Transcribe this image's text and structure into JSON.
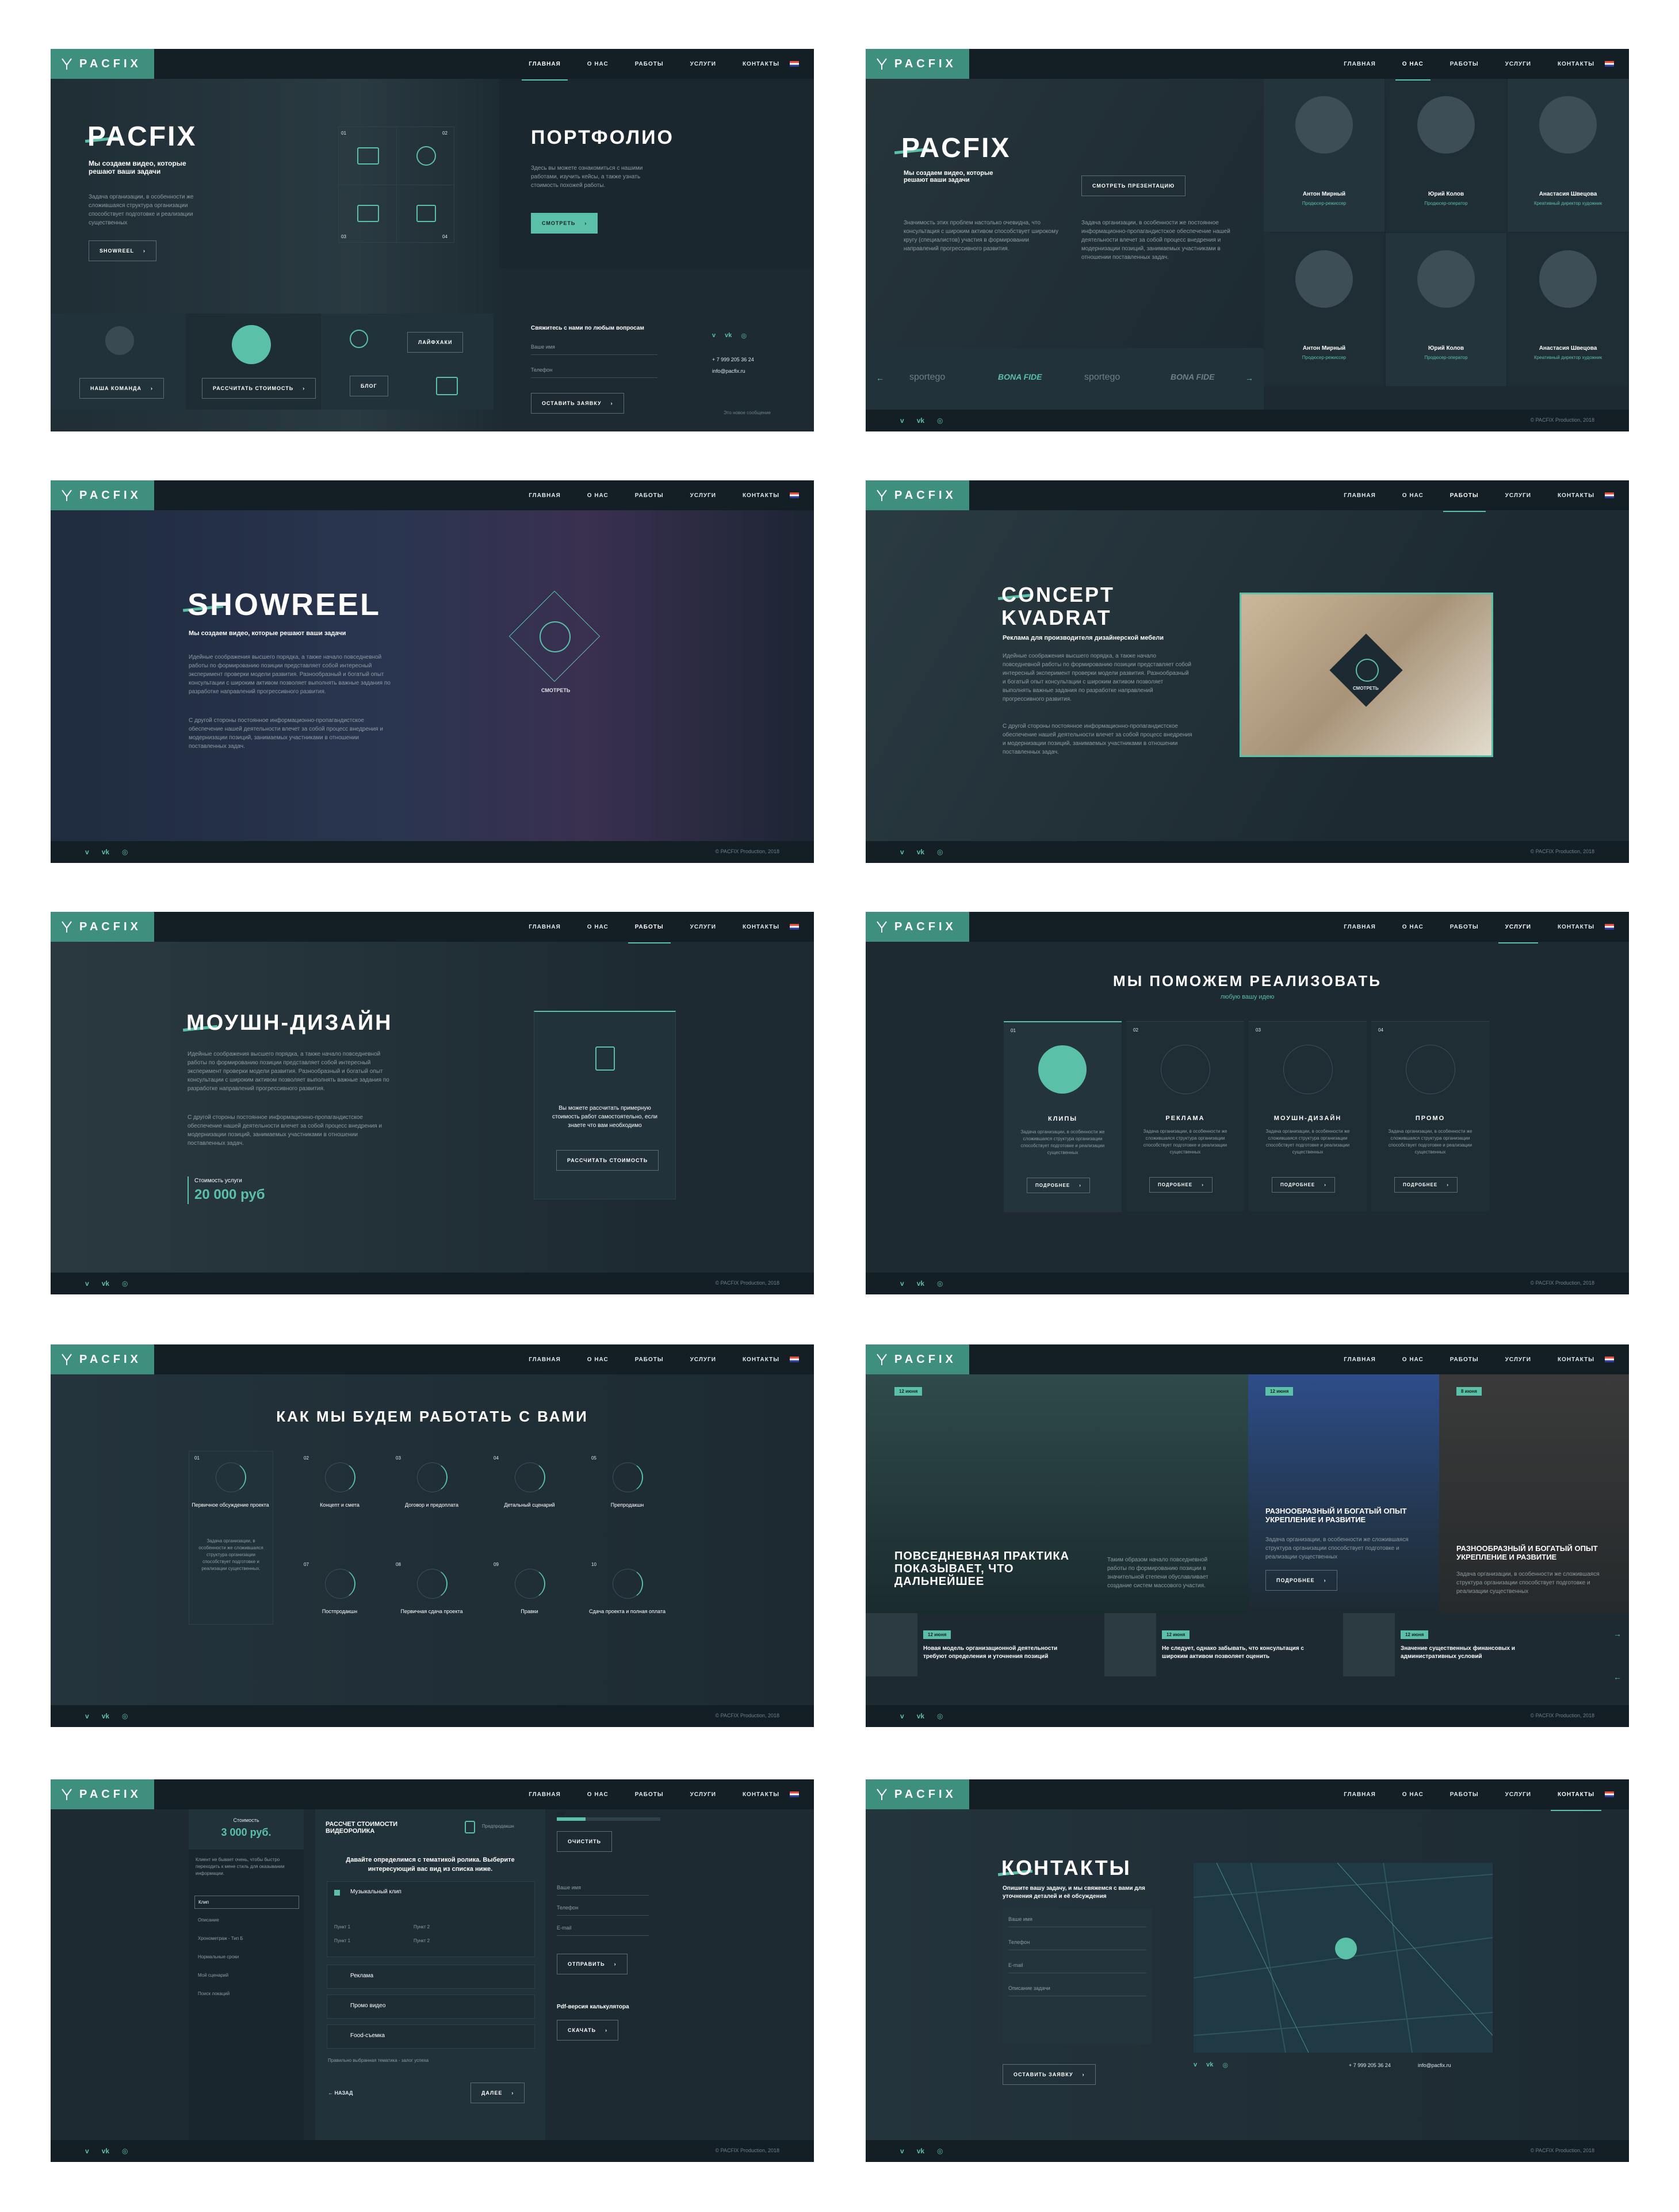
{
  "brand": {
    "name": "PACFIX",
    "accent": "#5bc0a8",
    "logo_bg": "#3f8f7e",
    "dark": "#1d2a32"
  },
  "nav": {
    "main": "ГЛАВНАЯ",
    "about": "О НАС",
    "works": "РАБОТЫ",
    "services": "УСЛУГИ",
    "contacts": "КОНТАКТЫ"
  },
  "footer": {
    "vimeo": "v",
    "vk": "vk",
    "instagram": "◎",
    "copyright": "© PACFIX Production, 2018"
  },
  "s1": {
    "title": "PACFIX",
    "tagline": "Мы создаем видео, которые решают ваши задачи",
    "text": "Задача организации, в особенности же сложившаяся структура организации способствует подготовке и реализации существенных",
    "showreel": "SHOWREEL",
    "n1": "01",
    "n2": "02",
    "n3": "03",
    "n4": "04",
    "portfolio": "ПОРТФОЛИО",
    "portfolio_text": "Здесь вы можете ознакомиться с нашими работами, изучить кейсы, а также узнать стоимость похожей работы.",
    "watch": "СМОТРЕТЬ",
    "team": "НАША КОМАНДА",
    "calc": "РАССЧИТАТЬ СТОИМОСТЬ",
    "lifehack": "ЛАЙФХАКИ",
    "blog": "БЛОГ",
    "contact_head": "Свяжитесь с нами по любым вопросам",
    "name_ph": "Ваше имя",
    "phone_ph": "Телефон",
    "send": "ОСТАВИТЬ ЗАЯВКУ",
    "phone": "+ 7 999 205 36 24",
    "email": "info@pacfix.ru",
    "small": "Это новое сообщение"
  },
  "s2": {
    "title": "PACFIX",
    "tagline": "Мы создаем видео, которые решают ваши задачи",
    "present": "СМОТРЕТЬ ПРЕЗЕНТАЦИЮ",
    "text1": "Значимость этих проблем настолько очевидна, что консультация с широким активом способствует широкому кругу (специалистов) участия в формировании направлений прогрессивного развития.",
    "text2": "Задача организации, в особенности же постоянное информационно-пропагандистское обеспечение нашей деятельности влечет за собой процесс внедрения и модернизации позиций, занимаемых участниками в отношении поставленных задач.",
    "people": [
      {
        "name": "Антон Мирный",
        "role": "Продюсер-режиссер"
      },
      {
        "name": "Юрий Колов",
        "role": "Продюсер-оператор"
      },
      {
        "name": "Анастасия Швецова",
        "role": "Креативный директор художник"
      },
      {
        "name": "Антон Мирный",
        "role": "Продюсер-режиссер"
      },
      {
        "name": "Юрий Колов",
        "role": "Продюсер-оператор"
      },
      {
        "name": "Анастасия Швецова",
        "role": "Креативный директор художник"
      }
    ],
    "clients": [
      "sportego",
      "BONA FIDE",
      "sportego",
      "BONA FIDE"
    ]
  },
  "s3": {
    "title": "SHOWREEL",
    "tagline": "Мы создаем видео, которые решают ваши задачи",
    "text1": "Идейные соображения высшего порядка, а также начало повседневной работы по формированию позиции представляет собой интересный эксперимент проверки модели развития. Разнообразный и богатый опыт консультации с широким активом позволяет выполнять важные задания по разработке направлений прогрессивного развития.",
    "text2": "С другой стороны постоянное информационно-пропагандистское обеспечение нашей деятельности влечет за собой процесс внедрения и модернизации позиций, занимаемых участниками в отношении поставленных задач.",
    "watch": "СМОТРЕТЬ"
  },
  "s4": {
    "title1": "CONCEPT",
    "title2": "KVADRAT",
    "tagline": "Реклама для производителя дизайнерской мебели",
    "text1": "Идейные соображения высшего порядка, а также начало повседневной работы по формированию позиции представляет собой интересный эксперимент проверки модели развития. Разнообразный и богатый опыт консультации с широким активом позволяет выполнять важные задания по разработке направлений прогрессивного развития.",
    "text2": "С другой стороны постоянное информационно-пропагандистское обеспечение нашей деятельности влечет за собой процесс внедрения и модернизации позиций, занимаемых участниками в отношении поставленных задач.",
    "watch": "СМОТРЕТЬ"
  },
  "s5": {
    "title": "МОУШН-ДИЗАЙН",
    "text1": "Идейные соображения высшего порядка, а также начало повседневной работы по формированию позиции представляет собой интересный эксперимент проверки модели развития. Разнообразный и богатый опыт консультации с широким активом позволяет выполнять важные задания по разработке направлений прогрессивного развития.",
    "text2": "С другой стороны постоянное информационно-пропагандистское обеспечение нашей деятельности влечет за собой процесс внедрения и модернизации позиций, занимаемых участниками в отношении поставленных задач.",
    "price_label": "Стоимость услуги",
    "price": "20 000 руб",
    "calc_text": "Вы можете рассчитать примерную стоимость работ самостоятельно, если знаете что вам необходимо",
    "calc": "РАССЧИТАТЬ СТОИМОСТЬ"
  },
  "s6": {
    "title": "МЫ ПОМОЖЕМ РЕАЛИЗОВАТЬ",
    "subtitle": "любую вашу идею",
    "cards": [
      {
        "num": "01",
        "name": "КЛИПЫ",
        "text": "Задача организации, в особенности же сложившаяся структура организации способствует подготовке и реализации существенных",
        "more": "ПОДРОБНЕЕ"
      },
      {
        "num": "02",
        "name": "РЕКЛАМА",
        "text": "Задача организации, в особенности же сложившаяся структура организации способствует подготовке и реализации существенных",
        "more": "ПОДРОБНЕЕ"
      },
      {
        "num": "03",
        "name": "МОУШН-ДИЗАЙН",
        "text": "Задача организации, в особенности же сложившаяся структура организации способствует подготовке и реализации существенных",
        "more": "ПОДРОБНЕЕ"
      },
      {
        "num": "04",
        "name": "ПРОМО",
        "text": "Задача организации, в особенности же сложившаяся структура организации способствует подготовке и реализации существенных",
        "more": "ПОДРОБНЕЕ"
      }
    ]
  },
  "s7": {
    "title": "КАК МЫ БУДЕМ РАБОТАТЬ С ВАМИ",
    "first_text": "Задача организации, в особенности же сложившаяся структура организации способствует подготовке и реализации существенных.",
    "steps": [
      {
        "num": "01",
        "name": "Первичное обсуждение проекта"
      },
      {
        "num": "02",
        "name": "Концепт и смета"
      },
      {
        "num": "03",
        "name": "Договор и предоплата"
      },
      {
        "num": "04",
        "name": "Детальный сценарий"
      },
      {
        "num": "05",
        "name": "Препродакшн"
      },
      {
        "num": "07",
        "name": "Постпродакшн"
      },
      {
        "num": "08",
        "name": "Первичная сдача проекта"
      },
      {
        "num": "09",
        "name": "Правки"
      },
      {
        "num": "10",
        "name": "Сдача проекта и полная оплата"
      }
    ]
  },
  "s8": {
    "big_date": "12 июня",
    "big_title": "ПОВСЕДНЕВНАЯ ПРАКТИКА ПОКАЗЫВАЕТ, ЧТО ДАЛЬНЕЙШЕЕ",
    "big_text": "Таким образом начало повседневной работы по формированию позиции в значительной степени обуславливает создание систем массового участия.",
    "mid_date": "12 июня",
    "mid_title": "РАЗНООБРАЗНЫЙ И БОГАТЫЙ ОПЫТ УКРЕПЛЕНИЕ И РАЗВИТИЕ",
    "mid_text": "Задача организации, в особенности же сложившаяся структура организации способствует подготовке и реализации существенных",
    "more": "ПОДРОБНЕЕ",
    "right_date": "8 июня",
    "right_title": "РАЗНООБРАЗНЫЙ И БОГАТЫЙ ОПЫТ УКРЕПЛЕНИЕ И РАЗВИТИЕ",
    "right_text": "Задача организации, в особенности же сложившаяся структура организации способствует подготовке и реализации существенных",
    "small": [
      {
        "date": "12 июня",
        "title": "Новая модель организационной деятельности требуют определения и уточнения позиций"
      },
      {
        "date": "12 июня",
        "title": "Не следует, однако забывать, что консультация с широким активом позволяет оценить"
      },
      {
        "date": "12 июня",
        "title": "Значение существенных финансовых и административных условий"
      }
    ]
  },
  "s9": {
    "cost_label": "Стоимость",
    "cost": "3 000 руб.",
    "side_text": "Клиент не бывает очень, чтобы быстро переходить к мене стиль для оказывании информации.",
    "side_items": [
      "Клип",
      "Описание",
      "Хронометраж - Тип Б",
      "Нормальные сроки",
      "Мой сценарий",
      "Поиск локаций"
    ],
    "head": "РАССЧЕТ СТОИМОСТИ ВИДЕОРОЛИКА",
    "step_note": "Предпродакшн",
    "question": "Давайте определимся с тематикой ролика. Выберите интересующий вас вид из списка ниже.",
    "opt_music": "Музыкальный клип",
    "sub": [
      "Пункт 1",
      "Пункт 2",
      "Пункт 1",
      "Пункт 2"
    ],
    "opts": [
      "Реклама",
      "Промо видео",
      "Food-съемка"
    ],
    "hint": "Правильно выбранная тематика - залог успеха",
    "back": "НАЗАД",
    "next": "ДАЛЕЕ",
    "progress": "28%",
    "clear": "ОЧИСТИТЬ",
    "name_ph": "Ваше имя",
    "phone_ph": "Телефон",
    "email_ph": "E-mail",
    "send": "ОТПРАВИТЬ",
    "pdf": "Pdf-версия калькулятора",
    "download": "СКАЧАТЬ"
  },
  "s10": {
    "title": "КОНТАКТЫ",
    "tagline": "Опишите вашу задачу, и мы свяжемся с вами для уточнения деталей и её обсуждения",
    "name_ph": "Ваше имя",
    "phone_ph": "Телефон",
    "email_ph": "E-mail",
    "desc_ph": "Описание задачи",
    "send": "ОСТАВИТЬ ЗАЯВКУ",
    "phone": "+ 7 999 205 36 24",
    "email": "info@pacfix.ru"
  }
}
